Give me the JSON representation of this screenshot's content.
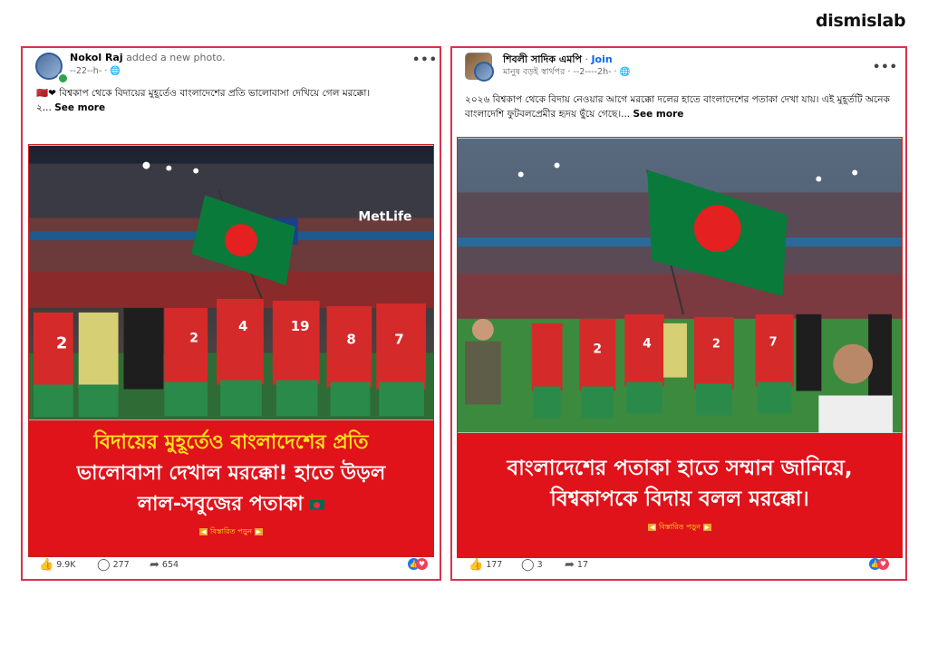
{
  "brand": {
    "logo": "dismislab"
  },
  "posts": [
    {
      "author": "Nokol Raj",
      "action": "added a new photo.",
      "meta": "--22--h- · ",
      "caption_emoji": "🇲🇦❤",
      "caption": "বিশ্বকাপ থেকে বিদায়ের মুহূর্তেও বাংলাদেশের প্রতি ভালোবাসা দেখিয়ে গেল মরক্কো।",
      "caption_more_prefix": "২...",
      "see_more": "See more",
      "banner_lines": [
        "বিদায়ের মুহূর্তেও বাংলাদেশের প্রতি",
        "ভালোবাসা দেখাল মরক্কো! হাতে উড়ল",
        "লাল-সবুজের পতাকা"
      ],
      "read_more": "বিস্তারিত পড়ুন",
      "likes": "9.9K",
      "comments": "277",
      "shares": "654"
    },
    {
      "author": "শিবলী সাদিক এমপি",
      "join": "Join",
      "group": "মানুষ বড়ই স্বার্থপর",
      "meta": "· --2----2h- · ",
      "caption": "২০২৬ বিশ্বকাপ থেকে বিদায় নেওয়ার আগে মরক্কো দলের হাতে বাংলাদেশের পতাকা দেখা যায়। এই মুহূর্তটি অনেক বাংলাদেশি ফুটবলপ্রেমীর হৃদয় ছুঁয়ে গেছে।...",
      "see_more": "See more",
      "banner_lines": [
        "বাংলাদেশের পতাকা হাতে সম্মান জানিয়ে,",
        "বিশ্বকাপকে বিদায় বলল মরক্কো।"
      ],
      "read_more": "বিস্তারিত পড়ুন",
      "likes": "177",
      "comments": "3",
      "shares": "17"
    }
  ],
  "colors": {
    "accent_border": "#d6334f",
    "banner_red": "#e0121a",
    "banner_yellow": "#ffe31a",
    "like_blue": "#1877f2"
  }
}
